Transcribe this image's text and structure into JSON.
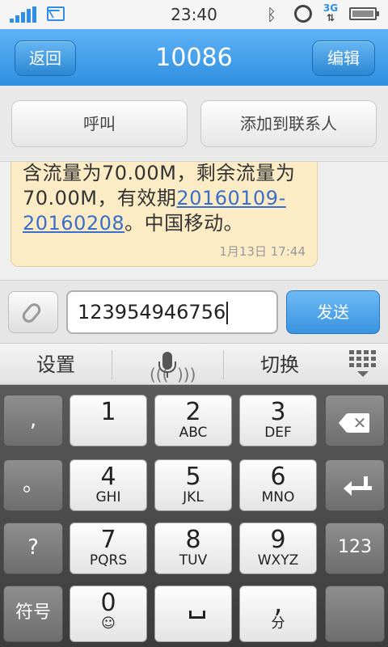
{
  "status_bar": {
    "time": "23:40",
    "network": "3G"
  },
  "header": {
    "back_label": "返回",
    "title": "10086",
    "edit_label": "编辑"
  },
  "actions": {
    "call_label": "呼叫",
    "add_contact_label": "添加到联系人"
  },
  "message": {
    "text_before": "含流量为70.00M，剩余流量为70.00M，有效期",
    "link_text": "20160109-20160208",
    "text_after": "。中国移动。",
    "timestamp": "1月13日 17:44"
  },
  "compose": {
    "input_value": "123954946756",
    "send_label": "发送"
  },
  "ime_toolbar": {
    "settings_label": "设置",
    "switch_label": "切换"
  },
  "keyboard": {
    "rows": [
      [
        {
          "digit": "1",
          "letters": ""
        },
        {
          "digit": "2",
          "letters": "ABC"
        },
        {
          "digit": "3",
          "letters": "DEF"
        }
      ],
      [
        {
          "digit": "4",
          "letters": "GHI"
        },
        {
          "digit": "5",
          "letters": "JKL"
        },
        {
          "digit": "6",
          "letters": "MNO"
        }
      ],
      [
        {
          "digit": "7",
          "letters": "PQRS"
        },
        {
          "digit": "8",
          "letters": "TUV"
        },
        {
          "digit": "9",
          "letters": "WXYZ"
        }
      ]
    ],
    "zero_digit": "0",
    "zero_sub": "☺",
    "left_keys": [
      ",",
      "。",
      "?",
      "符号"
    ],
    "numeric_switch": "123",
    "comma_key": ",",
    "comma_sub": "分"
  }
}
